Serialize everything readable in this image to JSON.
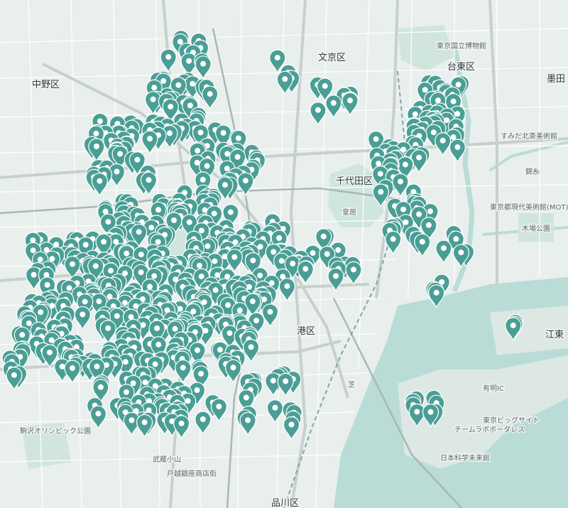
{
  "labels": {
    "nakano": "中野区",
    "bunkyo": "文京区",
    "taito": "台東区",
    "sumida": "墨田",
    "chiyoda": "千代田区",
    "tokyo": "東京",
    "minato": "港区",
    "koto": "江東",
    "shinagawa": "品川区",
    "komazawa": "駒沢オリンピック公園",
    "kiba": "木場公園",
    "teamlab": "チームラボボーダレス",
    "kokuritsu": "東京国立博物館",
    "sumida_museum": "すみだ北斎美術館",
    "mot": "東京都現代美術館(MOT)",
    "miraikan": "日本科学未来館",
    "big_sight": "東京ビッグサイト",
    "musashikoyama": "武蔵小山",
    "togoshi": "戸越銀座商店街",
    "ariake": "有明IC",
    "kokyo": "皇居",
    "kinshicho": "錦糸",
    "shiba": "芝"
  },
  "colors": {
    "marker": "#4a9e95",
    "marker_dot": "#ffffff",
    "land": "#e9efed",
    "water": "#b9dcd7",
    "park": "#cfe5de",
    "road": "#ffffff",
    "major_road": "#c7d0cd"
  },
  "marker_icon": "map-pin-icon"
}
